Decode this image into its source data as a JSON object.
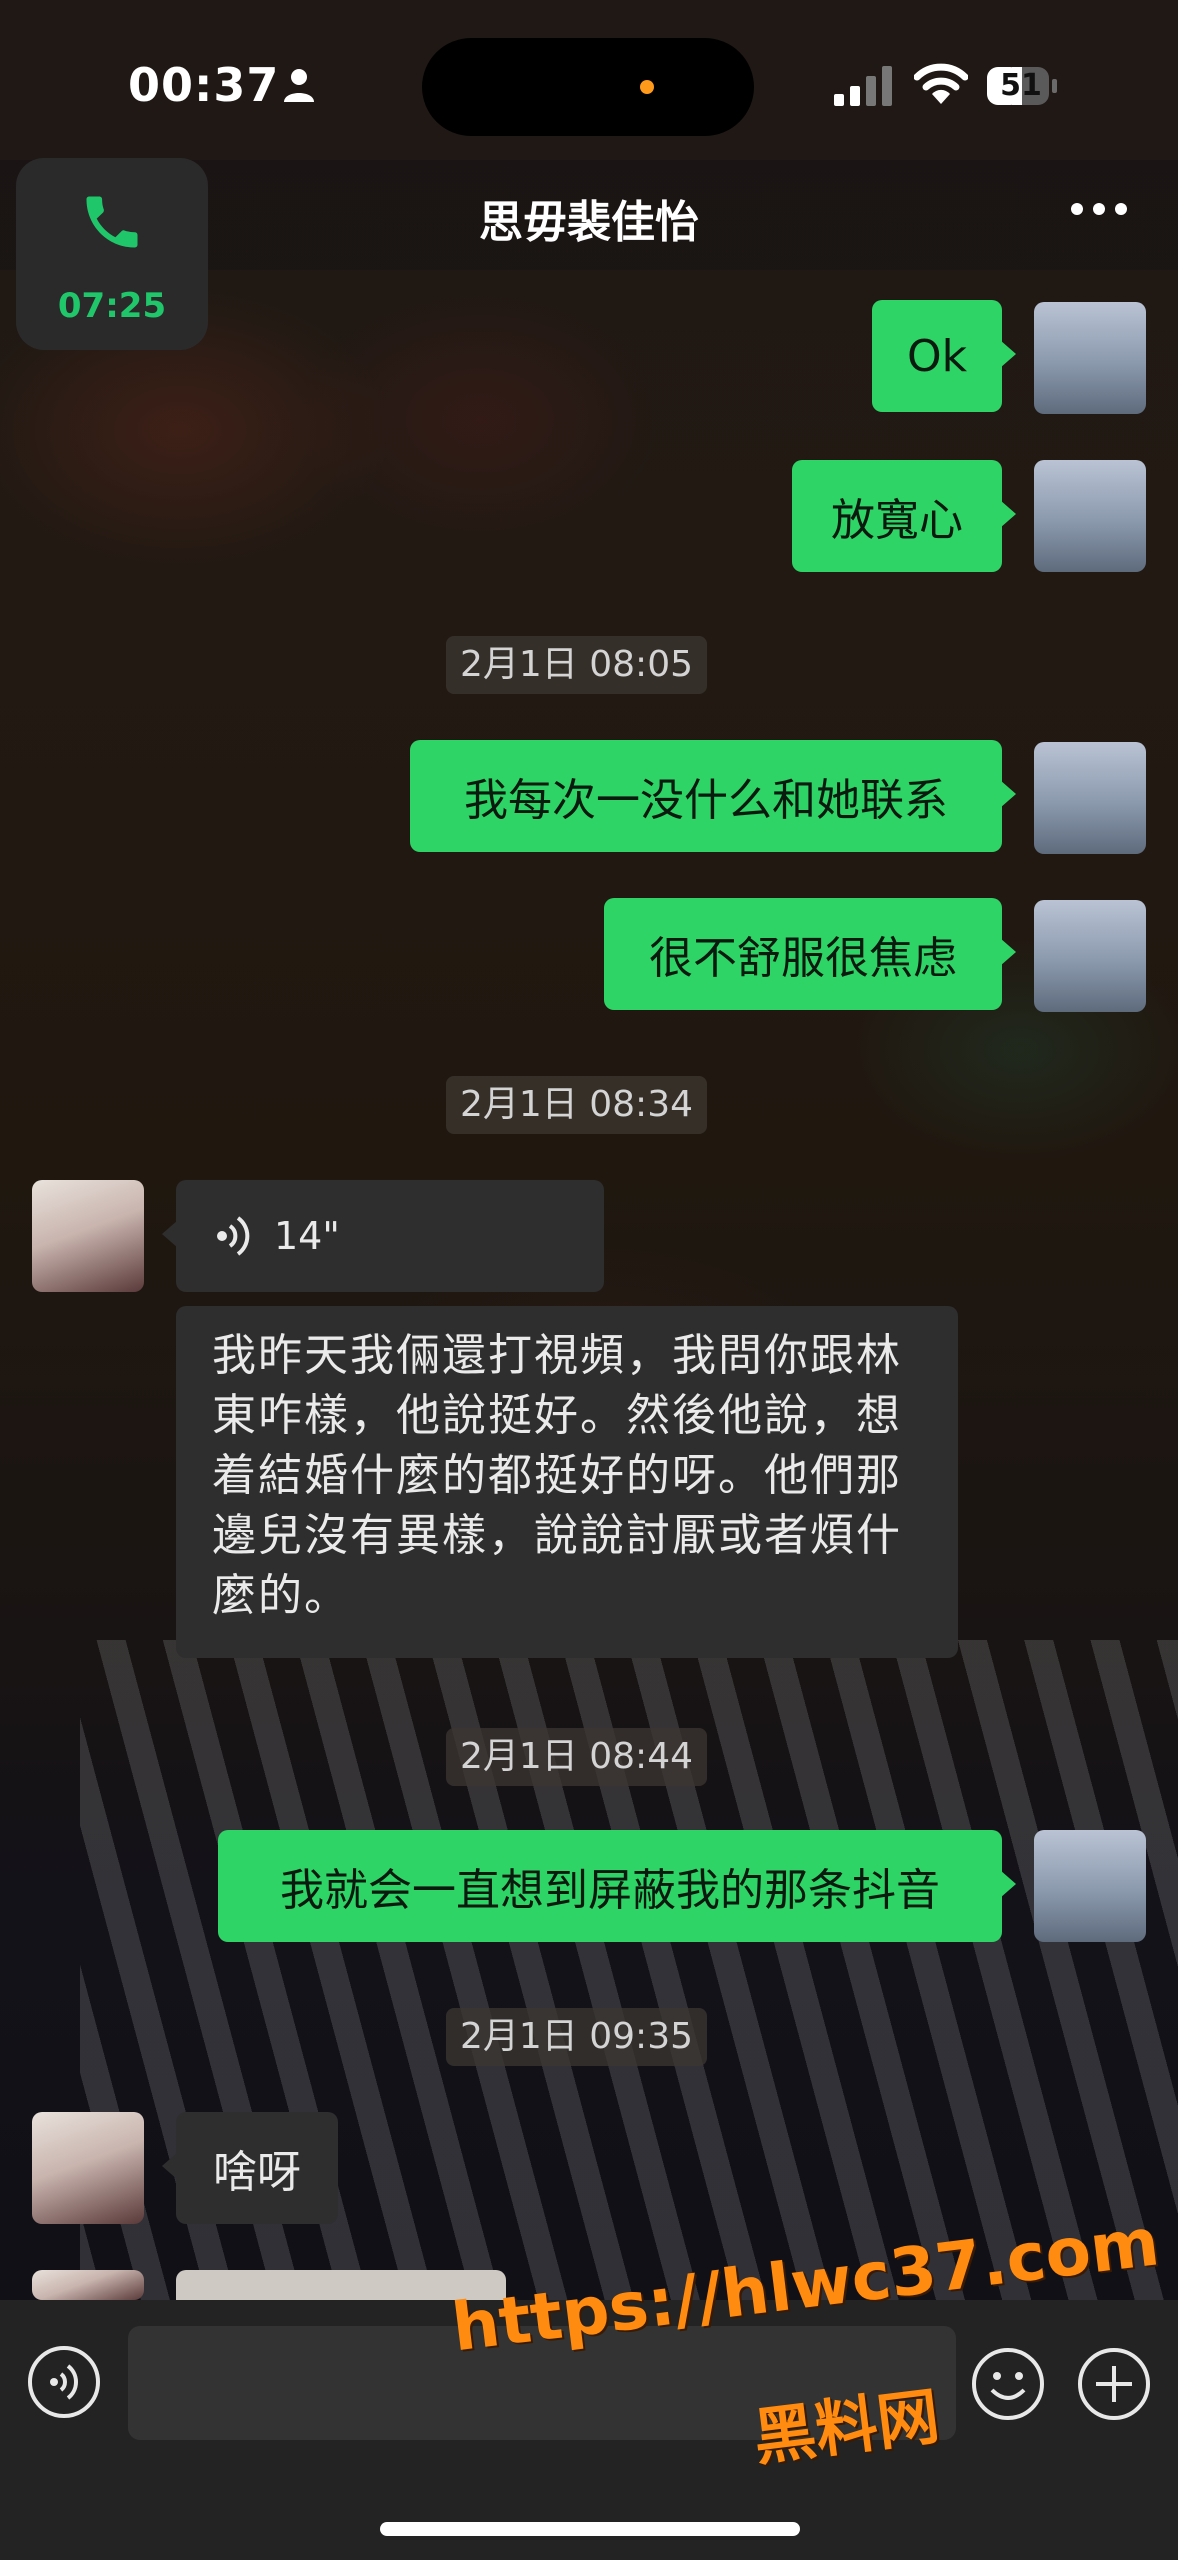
{
  "status_bar": {
    "time": "00:37",
    "battery": "51"
  },
  "header": {
    "title": "思毋裴佳怡",
    "call_timer": "07:25"
  },
  "messages": [
    {
      "from": "me",
      "text": "Ok"
    },
    {
      "from": "me",
      "text": "放寬心"
    },
    {
      "type": "timestamp",
      "text": "2月1日 08:05"
    },
    {
      "from": "me",
      "text": "我每次一没什么和她联系"
    },
    {
      "from": "me",
      "text": "很不舒服很焦虑"
    },
    {
      "type": "timestamp",
      "text": "2月1日 08:34"
    },
    {
      "from": "her",
      "type": "voice",
      "duration": "14\""
    },
    {
      "from": "her",
      "type": "transcript",
      "lines": [
        "我昨天我倆還打視頻，我問你跟林",
        "東咋樣，他說挺好。然後他說，想",
        "着結婚什麼的都挺好的呀。他們那",
        "邊兒沒有異樣，說說討厭或者煩什",
        "麼的。"
      ]
    },
    {
      "type": "timestamp",
      "text": "2月1日 08:44"
    },
    {
      "from": "me",
      "text": "我就会一直想到屏蔽我的那条抖音"
    },
    {
      "type": "timestamp",
      "text": "2月1日 09:35"
    },
    {
      "from": "her",
      "text": "啥呀"
    }
  ],
  "watermark": {
    "url": "https://hlwc37.com",
    "name": "黑料网"
  },
  "colors": {
    "bubble_me": "#2fd466",
    "bubble_her": "#2e2e2e",
    "call_green": "#1fc76a",
    "watermark": "#ff8c10"
  }
}
